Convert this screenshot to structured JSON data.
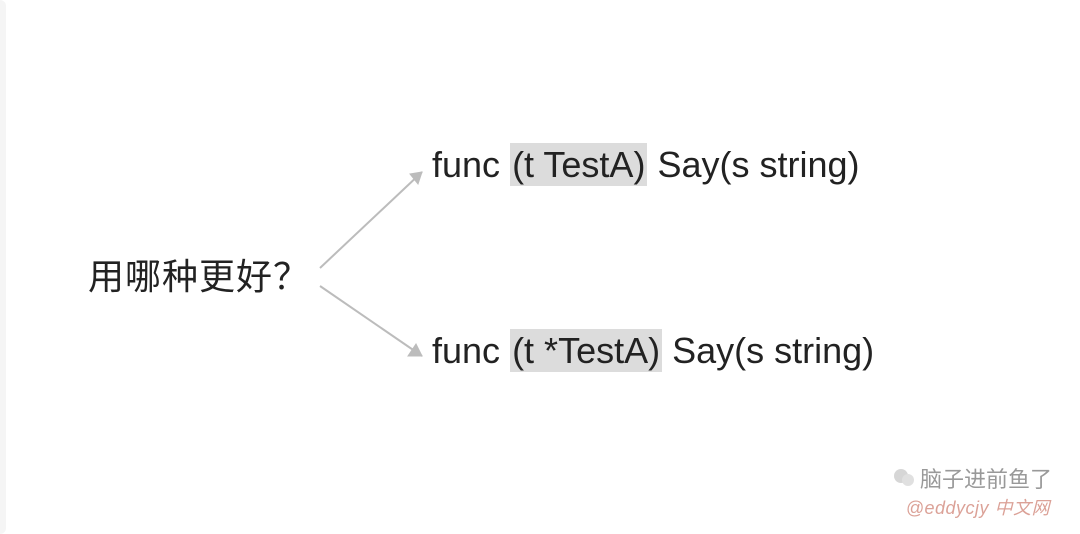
{
  "question": "用哪种更好？",
  "option1": {
    "keyword": "func",
    "receiver": "(t TestA)",
    "suffix": " Say(s string)"
  },
  "option2": {
    "keyword": "func",
    "receiver": "(t *TestA)",
    "suffix": " Say(s string)"
  },
  "watermark_main": "脑子进前鱼了",
  "watermark_sub": "@eddycjy 中文网"
}
